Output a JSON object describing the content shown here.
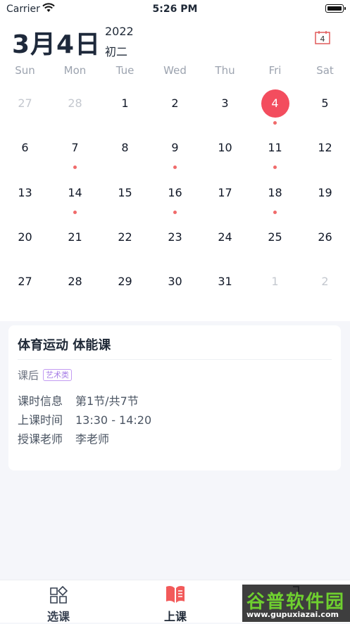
{
  "status_bar": {
    "carrier": "Carrier",
    "time": "5:26 PM"
  },
  "header": {
    "date": "3月4日",
    "year": "2022",
    "lunar": "初二",
    "calendar_icon_day": "4"
  },
  "weekdays": [
    "Sun",
    "Mon",
    "Tue",
    "Wed",
    "Thu",
    "Fri",
    "Sat"
  ],
  "weeks": [
    [
      {
        "d": "27",
        "muted": true
      },
      {
        "d": "28",
        "muted": true
      },
      {
        "d": "1"
      },
      {
        "d": "2"
      },
      {
        "d": "3"
      },
      {
        "d": "4",
        "selected": true,
        "dot": true
      },
      {
        "d": "5"
      }
    ],
    [
      {
        "d": "6"
      },
      {
        "d": "7",
        "dot": true
      },
      {
        "d": "8"
      },
      {
        "d": "9",
        "dot": true
      },
      {
        "d": "10"
      },
      {
        "d": "11",
        "dot": true
      },
      {
        "d": "12"
      }
    ],
    [
      {
        "d": "13"
      },
      {
        "d": "14",
        "dot": true
      },
      {
        "d": "15"
      },
      {
        "d": "16",
        "dot": true
      },
      {
        "d": "17"
      },
      {
        "d": "18",
        "dot": true
      },
      {
        "d": "19"
      }
    ],
    [
      {
        "d": "20"
      },
      {
        "d": "21"
      },
      {
        "d": "22"
      },
      {
        "d": "23"
      },
      {
        "d": "24"
      },
      {
        "d": "25"
      },
      {
        "d": "26"
      }
    ],
    [
      {
        "d": "27"
      },
      {
        "d": "28"
      },
      {
        "d": "29"
      },
      {
        "d": "30"
      },
      {
        "d": "31"
      },
      {
        "d": "1",
        "muted": true
      },
      {
        "d": "2",
        "muted": true
      }
    ]
  ],
  "course": {
    "title": "体育运动  体能课",
    "category": "课后",
    "tag": "艺术类",
    "rows": [
      {
        "key": "课时信息",
        "value": "第1节/共7节"
      },
      {
        "key": "上课时间",
        "value": "13:30 - 14:20"
      },
      {
        "key": "授课老师",
        "value": "李老师"
      }
    ]
  },
  "tabs": [
    {
      "label": "选课"
    },
    {
      "label": "上课"
    }
  ],
  "watermark": {
    "text": "谷普软件园",
    "url": "www.gupuxiazai.com"
  },
  "colors": {
    "accent": "#f34d5e",
    "dot": "#f06b6b",
    "tag_border": "#c39bf2"
  }
}
